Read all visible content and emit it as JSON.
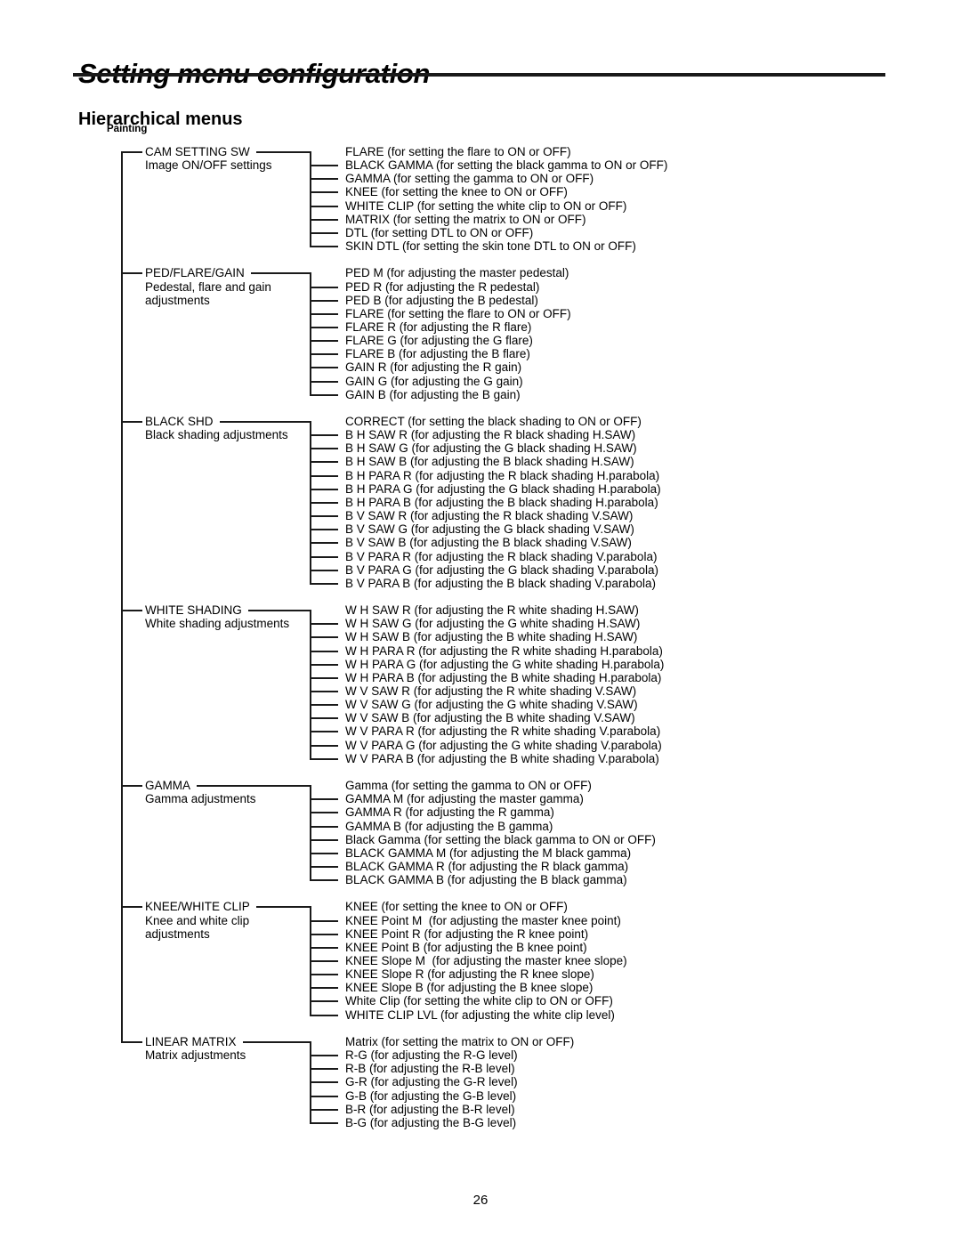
{
  "header": {
    "title": "Setting menu configuration",
    "section": "Hierarchical menus",
    "group": "Painting"
  },
  "footer": {
    "page_number": "26"
  },
  "tree": {
    "root": "Painting",
    "nodes": [
      {
        "title": "CAM SETTING SW",
        "desc": "Image ON/OFF settings",
        "desc2": "",
        "children": [
          "FLARE (for setting the flare to ON or OFF)",
          "BLACK GAMMA (for setting the black gamma to ON or OFF)",
          "GAMMA (for setting the gamma to ON or OFF)",
          "KNEE (for setting the knee to ON or OFF)",
          "WHITE CLIP (for setting the white clip to ON or OFF)",
          "MATRIX (for setting the matrix to ON or OFF)",
          "DTL (for setting DTL to ON or OFF)",
          "SKIN DTL (for setting the skin tone DTL to ON or OFF)"
        ]
      },
      {
        "title": "PED/FLARE/GAIN",
        "desc": "Pedestal, flare and gain",
        "desc2": "adjustments",
        "children": [
          "PED M (for adjusting the master pedestal)",
          "PED R (for adjusting the R pedestal)",
          "PED B (for adjusting the B pedestal)",
          "FLARE (for setting the flare to ON or OFF)",
          "FLARE R (for adjusting the R flare)",
          "FLARE G (for adjusting the G flare)",
          "FLARE B (for adjusting the B flare)",
          "GAIN R (for adjusting the R gain)",
          "GAIN G (for adjusting the G gain)",
          "GAIN B (for adjusting the B gain)"
        ]
      },
      {
        "title": "BLACK SHD",
        "desc": "Black shading adjustments",
        "desc2": "",
        "children": [
          "CORRECT (for setting the black shading to ON or OFF)",
          "B H SAW R (for adjusting the R black shading H.SAW)",
          "B H SAW G (for adjusting the G black shading H.SAW)",
          "B H SAW B (for adjusting the B black shading H.SAW)",
          "B H PARA R (for adjusting the R black shading H.parabola)",
          "B H PARA G (for adjusting the G black shading H.parabola)",
          "B H PARA B (for adjusting the B black shading H.parabola)",
          "B V SAW R (for adjusting the R black shading V.SAW)",
          "B V SAW G (for adjusting the G black shading V.SAW)",
          "B V SAW B (for adjusting the B black shading V.SAW)",
          "B V PARA R (for adjusting the R black shading V.parabola)",
          "B V PARA G (for adjusting the G black shading V.parabola)",
          "B V PARA B (for adjusting the B black shading V.parabola)"
        ]
      },
      {
        "title": "WHITE SHADING",
        "desc": "White shading adjustments",
        "desc2": "",
        "children": [
          "W H SAW R (for adjusting the R white shading H.SAW)",
          "W H SAW G (for adjusting the G white shading H.SAW)",
          "W H SAW B (for adjusting the B white shading H.SAW)",
          "W H PARA R (for adjusting the R white shading H.parabola)",
          "W H PARA G (for adjusting the G white shading H.parabola)",
          "W H PARA B (for adjusting the B white shading H.parabola)",
          "W V SAW R (for adjusting the R white shading V.SAW)",
          "W V SAW G (for adjusting the G white shading V.SAW)",
          "W V SAW B (for adjusting the B white shading V.SAW)",
          "W V PARA R (for adjusting the R white shading V.parabola)",
          "W V PARA G (for adjusting the G white shading V.parabola)",
          "W V PARA B (for adjusting the B white shading V.parabola)"
        ]
      },
      {
        "title": "GAMMA",
        "desc": "Gamma adjustments",
        "desc2": "",
        "children": [
          "Gamma (for setting the gamma to ON or OFF)",
          "GAMMA M (for adjusting the master gamma)",
          "GAMMA R (for adjusting the R gamma)",
          "GAMMA B (for adjusting the B gamma)",
          "Black Gamma (for setting the black gamma to ON or OFF)",
          "BLACK GAMMA M (for adjusting the M black gamma)",
          "BLACK GAMMA R (for adjusting the R black gamma)",
          "BLACK GAMMA B (for adjusting the B black gamma)"
        ]
      },
      {
        "title": "KNEE/WHITE CLIP",
        "desc": "Knee and white clip",
        "desc2": "adjustments",
        "children": [
          "KNEE (for setting the knee to ON or OFF)",
          "KNEE Point M  (for adjusting the master knee point)",
          "KNEE Point R (for adjusting the R knee point)",
          "KNEE Point B (for adjusting the B knee point)",
          "KNEE Slope M  (for adjusting the master knee slope)",
          "KNEE Slope R (for adjusting the R knee slope)",
          "KNEE Slope B (for adjusting the B knee slope)",
          "White Clip (for setting the white clip to ON or OFF)",
          "WHITE CLIP LVL (for adjusting the white clip level)"
        ]
      },
      {
        "title": "LINEAR MATRIX",
        "desc": "Matrix adjustments",
        "desc2": "",
        "children": [
          "Matrix (for setting the matrix to ON or OFF)",
          "R-G (for adjusting the R-G level)",
          "R-B (for adjusting the R-B level)",
          "G-R (for adjusting the G-R level)",
          "G-B (for adjusting the G-B level)",
          "B-R (for adjusting the B-R level)",
          "B-G (for adjusting the B-G level)"
        ]
      }
    ]
  }
}
